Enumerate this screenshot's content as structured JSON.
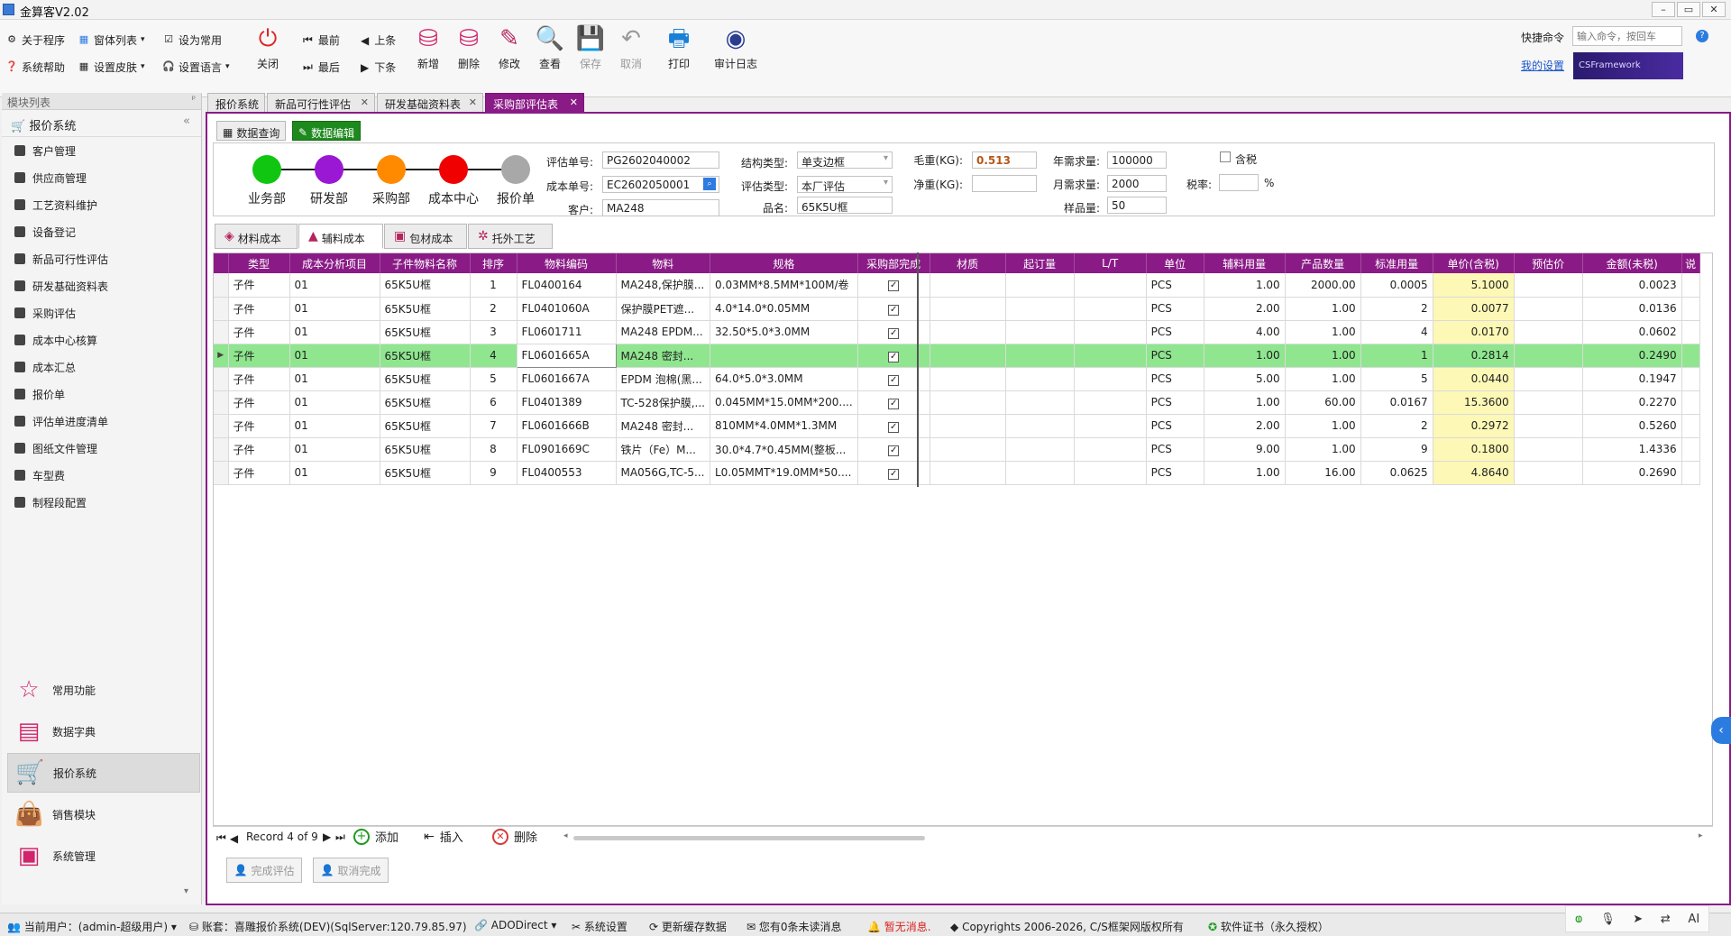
{
  "window": {
    "title": "金算客V2.02",
    "min": "–",
    "restore": "▭",
    "close": "✕"
  },
  "toolbar": {
    "small": [
      {
        "label": "关于程序",
        "icon": "gear-icon"
      },
      {
        "label": "窗体列表",
        "icon": "windows-icon"
      },
      {
        "label": "设为常用",
        "icon": "document-check-icon"
      },
      {
        "label": "系统帮助",
        "icon": "help-icon"
      },
      {
        "label": "设置皮肤",
        "icon": "skin-icon"
      },
      {
        "label": "设置语言",
        "icon": "headset-icon"
      }
    ],
    "close_label": "关闭",
    "nav": {
      "first": "最前",
      "prev": "上条",
      "last": "最后",
      "next": "下条"
    },
    "big": [
      {
        "label": "新增",
        "icon": "database-add-icon",
        "color": "#d1246b"
      },
      {
        "label": "删除",
        "icon": "database-delete-icon",
        "color": "#d1246b"
      },
      {
        "label": "修改",
        "icon": "edit-icon",
        "color": "#b5245c"
      },
      {
        "label": "查看",
        "icon": "view-icon",
        "color": "#333333"
      },
      {
        "label": "保存",
        "icon": "save-icon",
        "color": "#999999"
      },
      {
        "label": "取消",
        "icon": "undo-icon",
        "color": "#999999"
      },
      {
        "label": "打印",
        "icon": "printer-icon",
        "color": "#1a7fd6"
      },
      {
        "label": "审计日志",
        "icon": "audit-log-icon",
        "color": "#2a3d8f"
      }
    ],
    "quick_label": "快捷命令",
    "quick_placeholder": "输入命令，按回车",
    "my_settings": "我的设置",
    "brand": "CSFramework"
  },
  "sidebar": {
    "title": "模块列表",
    "system": "报价系统",
    "items": [
      "客户管理",
      "供应商管理",
      "工艺资料维护",
      "设备登记",
      "新品可行性评估",
      "研发基础资料表",
      "采购评估",
      "成本中心核算",
      "成本汇总",
      "报价单",
      "评估单进度清单",
      "图纸文件管理",
      "车型费",
      "制程段配置"
    ],
    "modules": [
      {
        "label": "常用功能",
        "icon": "star-icon"
      },
      {
        "label": "数据字典",
        "icon": "dictionary-icon"
      },
      {
        "label": "报价系统",
        "icon": "cart-icon",
        "active": true
      },
      {
        "label": "销售模块",
        "icon": "bag-icon"
      },
      {
        "label": "系统管理",
        "icon": "system-icon"
      }
    ]
  },
  "tabs": [
    {
      "label": "报价系统",
      "closable": false
    },
    {
      "label": "新品可行性评估",
      "closable": true
    },
    {
      "label": "研发基础资料表",
      "closable": true
    },
    {
      "label": "采购部评估表",
      "closable": true,
      "active": true
    }
  ],
  "subtabs": {
    "query": "数据查询",
    "edit": "数据编辑"
  },
  "workflow": [
    {
      "label": "业务部",
      "color": "#11c611"
    },
    {
      "label": "研发部",
      "color": "#9a17d3"
    },
    {
      "label": "采购部",
      "color": "#ff8a00"
    },
    {
      "label": "成本中心",
      "color": "#f00000"
    },
    {
      "label": "报价单",
      "color": "#a8a8a8"
    }
  ],
  "form": {
    "eval_no_label": "评估单号:",
    "eval_no": "PG2602040002",
    "cost_no_label": "成本单号:",
    "cost_no": "EC2602050001",
    "customer_label": "客户:",
    "customer": "MA248",
    "struct_label": "结构类型:",
    "struct": "单支边框",
    "eval_type_label": "评估类型:",
    "eval_type": "本厂评估",
    "product_label": "品名:",
    "product": "65K5U框",
    "gross_label": "毛重(KG):",
    "gross": "0.513",
    "net_label": "净重(KG):",
    "net": "",
    "annual_label": "年需求量:",
    "annual": "100000",
    "monthly_label": "月需求量:",
    "monthly": "2000",
    "sample_label": "样品量:",
    "sample": "50",
    "tax_label": "含税",
    "tax_rate_label": "税率:",
    "tax_rate": "",
    "percent": "%"
  },
  "grid_tabs": [
    {
      "label": "材料成本"
    },
    {
      "label": "辅料成本",
      "active": true
    },
    {
      "label": "包材成本"
    },
    {
      "label": "托外工艺"
    }
  ],
  "grid": {
    "columns": [
      "类型",
      "成本分析项目",
      "子件物料名称",
      "排序",
      "物料编码",
      "物料",
      "规格",
      "采购部完成",
      "材质",
      "起订量",
      "L/T",
      "单位",
      "辅料用量",
      "产品数量",
      "标准用量",
      "单价(含税)",
      "预估价",
      "金额(未税)",
      "说"
    ],
    "rows": [
      [
        "子件",
        "01",
        "65K5U框",
        "1",
        "FL0400164",
        "MA248,保护膜...",
        "0.03MM*8.5MM*100M/卷",
        "✓",
        "",
        "",
        "",
        "PCS",
        "1.00",
        "2000.00",
        "0.0005",
        "5.1000",
        "",
        "0.0023"
      ],
      [
        "子件",
        "01",
        "65K5U框",
        "2",
        "FL0401060A",
        "保护膜PET遮...",
        "4.0*14.0*0.05MM",
        "✓",
        "",
        "",
        "",
        "PCS",
        "2.00",
        "1.00",
        "2",
        "0.0077",
        "",
        "0.0136"
      ],
      [
        "子件",
        "01",
        "65K5U框",
        "3",
        "FL0601711",
        "MA248 EPDM...",
        "32.50*5.0*3.0MM",
        "✓",
        "",
        "",
        "",
        "PCS",
        "4.00",
        "1.00",
        "4",
        "0.0170",
        "",
        "0.0602"
      ],
      [
        "子件",
        "01",
        "65K5U框",
        "4",
        "FL0601665A",
        "MA248 密封...",
        "",
        "✓",
        "",
        "",
        "",
        "PCS",
        "1.00",
        "1.00",
        "1",
        "0.2814",
        "",
        "0.2490"
      ],
      [
        "子件",
        "01",
        "65K5U框",
        "5",
        "FL0601667A",
        "EPDM 泡棉(黑...",
        "64.0*5.0*3.0MM",
        "✓",
        "",
        "",
        "",
        "PCS",
        "5.00",
        "1.00",
        "5",
        "0.0440",
        "",
        "0.1947"
      ],
      [
        "子件",
        "01",
        "65K5U框",
        "6",
        "FL0401389",
        "TC-528保护膜,...",
        "0.045MM*15.0MM*200....",
        "✓",
        "",
        "",
        "",
        "PCS",
        "1.00",
        "60.00",
        "0.0167",
        "15.3600",
        "",
        "0.2270"
      ],
      [
        "子件",
        "01",
        "65K5U框",
        "7",
        "FL0601666B",
        "MA248 密封...",
        "810MM*4.0MM*1.3MM",
        "✓",
        "",
        "",
        "",
        "PCS",
        "2.00",
        "1.00",
        "2",
        "0.2972",
        "",
        "0.5260"
      ],
      [
        "子件",
        "01",
        "65K5U框",
        "8",
        "FL0901669C",
        "铁片（Fe）M...",
        "30.0*4.7*0.45MM(整板...",
        "✓",
        "",
        "",
        "",
        "PCS",
        "9.00",
        "1.00",
        "9",
        "0.1800",
        "",
        "1.4336"
      ],
      [
        "子件",
        "01",
        "65K5U框",
        "9",
        "FL0400553",
        "MA056G,TC-5...",
        "L0.05MMT*19.0MM*50....",
        "✓",
        "",
        "",
        "",
        "PCS",
        "1.00",
        "16.00",
        "0.0625",
        "4.8640",
        "",
        "0.2690"
      ]
    ],
    "selected_row": 3
  },
  "navigator": {
    "record_text": "Record 4 of 9",
    "add": "添加",
    "insert": "插入",
    "delete": "删除"
  },
  "bottom_buttons": {
    "complete": "完成评估",
    "cancel_complete": "取消完成"
  },
  "statusbar": {
    "user": "当前用户：(admin-超级用户)",
    "account": "账套：喜雕报价系统(DEV)(SqlServer:120.79.85.97)",
    "ado": "ADODirect",
    "settings": "系统设置",
    "refresh": "更新缓存数据",
    "messages": "您有0条未读消息",
    "nomsg": "暂无消息.",
    "copyright": "Copyrights 2006-2026, C/S框架网版权所有",
    "license": "软件证书（永久授权）"
  }
}
